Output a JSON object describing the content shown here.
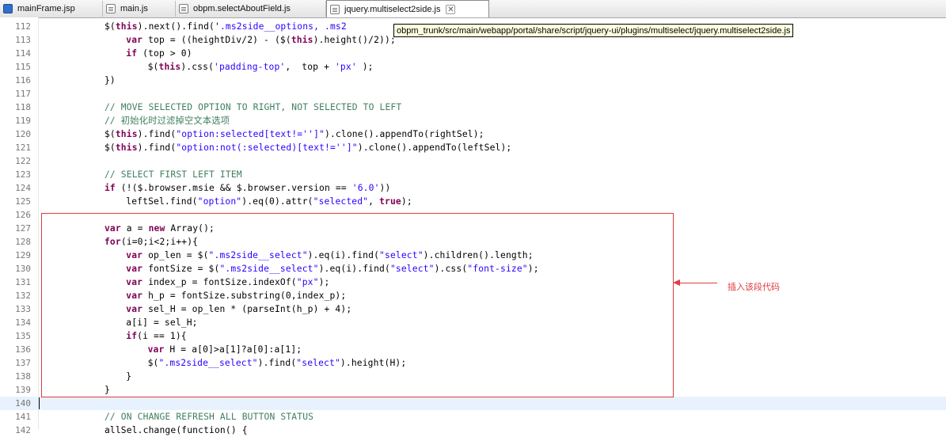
{
  "tabs": [
    {
      "label": "mainFrame.jsp",
      "icon": "jsp-file-icon"
    },
    {
      "label": "main.js",
      "icon": "js-file-icon"
    },
    {
      "label": "obpm.selectAboutField.js",
      "icon": "js-file-icon"
    },
    {
      "label": "jquery.multiselect2side.js",
      "icon": "js-file-icon",
      "active": true
    }
  ],
  "tooltip": "obpm_trunk/src/main/webapp/portal/share/script/jquery-ui/plugins/multiselect/jquery.multiselect2side.js",
  "annotation": {
    "text": "插入该段代码",
    "color": "#e23c3c"
  },
  "colors": {
    "keyword": "#7f0055",
    "string": "#2a00ff",
    "comment": "#3f7f5f",
    "line_number": "#787878"
  },
  "lines": [
    {
      "n": "112",
      "indent": 12,
      "tokens": [
        [
          "",
          "$("
        ],
        [
          "kw",
          "this"
        ],
        [
          "",
          ").next().find('"
        ],
        [
          "str",
          ".ms2side__options, .ms2"
        ]
      ]
    },
    {
      "n": "113",
      "indent": 16,
      "tokens": [
        [
          "kw",
          "var"
        ],
        [
          "",
          " top = ((heightDiv/2) - ($("
        ],
        [
          "kw",
          "this"
        ],
        [
          "",
          ").height()/2));"
        ]
      ]
    },
    {
      "n": "114",
      "indent": 16,
      "tokens": [
        [
          "kw",
          "if"
        ],
        [
          "",
          " (top > 0)"
        ]
      ]
    },
    {
      "n": "115",
      "indent": 20,
      "tokens": [
        [
          "",
          "$("
        ],
        [
          "kw",
          "this"
        ],
        [
          "",
          ").css("
        ],
        [
          "str",
          "'padding-top'"
        ],
        [
          "",
          ",  top + "
        ],
        [
          "str",
          "'px'"
        ],
        [
          "",
          " );"
        ]
      ]
    },
    {
      "n": "116",
      "indent": 12,
      "tokens": [
        [
          "",
          "})"
        ]
      ]
    },
    {
      "n": "117",
      "indent": 0,
      "tokens": []
    },
    {
      "n": "118",
      "indent": 12,
      "tokens": [
        [
          "cm",
          "// MOVE SELECTED OPTION TO RIGHT, NOT SELECTED TO LEFT"
        ]
      ]
    },
    {
      "n": "119",
      "indent": 12,
      "tokens": [
        [
          "cm",
          "// 初始化时过滤掉空文本选项"
        ]
      ]
    },
    {
      "n": "120",
      "indent": 12,
      "tokens": [
        [
          "",
          "$("
        ],
        [
          "kw",
          "this"
        ],
        [
          "",
          ").find("
        ],
        [
          "str",
          "\"option:selected[text!='']\""
        ],
        [
          "",
          ").clone().appendTo(rightSel);"
        ]
      ]
    },
    {
      "n": "121",
      "indent": 12,
      "tokens": [
        [
          "",
          "$("
        ],
        [
          "kw",
          "this"
        ],
        [
          "",
          ").find("
        ],
        [
          "str",
          "\"option:not(:selected)[text!='']\""
        ],
        [
          "",
          ").clone().appendTo(leftSel);"
        ]
      ]
    },
    {
      "n": "122",
      "indent": 0,
      "tokens": []
    },
    {
      "n": "123",
      "indent": 12,
      "tokens": [
        [
          "cm",
          "// SELECT FIRST LEFT ITEM"
        ]
      ]
    },
    {
      "n": "124",
      "indent": 12,
      "tokens": [
        [
          "kw",
          "if"
        ],
        [
          "",
          " (!($.browser.msie && $.browser.version == "
        ],
        [
          "str",
          "'6.0'"
        ],
        [
          "",
          "))"
        ]
      ]
    },
    {
      "n": "125",
      "indent": 16,
      "tokens": [
        [
          "",
          "leftSel.find("
        ],
        [
          "str",
          "\"option\""
        ],
        [
          "",
          ").eq(0).attr("
        ],
        [
          "str",
          "\"selected\""
        ],
        [
          "",
          ", "
        ],
        [
          "kw",
          "true"
        ],
        [
          "",
          ");"
        ]
      ]
    },
    {
      "n": "126",
      "indent": 0,
      "tokens": []
    },
    {
      "n": "127",
      "indent": 12,
      "tokens": [
        [
          "kw",
          "var"
        ],
        [
          "",
          " a = "
        ],
        [
          "kw",
          "new"
        ],
        [
          "",
          " Array();"
        ]
      ]
    },
    {
      "n": "128",
      "indent": 12,
      "tokens": [
        [
          "kw",
          "for"
        ],
        [
          "",
          "(i=0;i<2;i++){"
        ]
      ]
    },
    {
      "n": "129",
      "indent": 16,
      "tokens": [
        [
          "kw",
          "var"
        ],
        [
          "",
          " op_len = $("
        ],
        [
          "str",
          "\".ms2side__select\""
        ],
        [
          "",
          ").eq(i).find("
        ],
        [
          "str",
          "\"select\""
        ],
        [
          "",
          ").children().length;"
        ]
      ]
    },
    {
      "n": "130",
      "indent": 16,
      "tokens": [
        [
          "kw",
          "var"
        ],
        [
          "",
          " fontSize = $("
        ],
        [
          "str",
          "\".ms2side__select\""
        ],
        [
          "",
          ").eq(i).find("
        ],
        [
          "str",
          "\"select\""
        ],
        [
          "",
          ").css("
        ],
        [
          "str",
          "\"font-size\""
        ],
        [
          "",
          ");"
        ]
      ]
    },
    {
      "n": "131",
      "indent": 16,
      "tokens": [
        [
          "kw",
          "var"
        ],
        [
          "",
          " index_p = fontSize.indexOf("
        ],
        [
          "str",
          "\"px\""
        ],
        [
          "",
          ");"
        ]
      ]
    },
    {
      "n": "132",
      "indent": 16,
      "tokens": [
        [
          "kw",
          "var"
        ],
        [
          "",
          " h_p = fontSize.substring(0,index_p);"
        ]
      ]
    },
    {
      "n": "133",
      "indent": 16,
      "tokens": [
        [
          "kw",
          "var"
        ],
        [
          "",
          " sel_H = op_len * (parseInt(h_p) + 4);"
        ]
      ]
    },
    {
      "n": "134",
      "indent": 16,
      "tokens": [
        [
          "",
          "a[i] = sel_H;"
        ]
      ]
    },
    {
      "n": "135",
      "indent": 16,
      "tokens": [
        [
          "kw",
          "if"
        ],
        [
          "",
          "(i == 1){"
        ]
      ]
    },
    {
      "n": "136",
      "indent": 20,
      "tokens": [
        [
          "kw",
          "var"
        ],
        [
          "",
          " H = a[0]>a[1]?a[0]:a[1];"
        ]
      ]
    },
    {
      "n": "137",
      "indent": 20,
      "tokens": [
        [
          "",
          "$("
        ],
        [
          "str",
          "\".ms2side__select\""
        ],
        [
          "",
          ").find("
        ],
        [
          "str",
          "\"select\""
        ],
        [
          "",
          ").height(H);"
        ]
      ]
    },
    {
      "n": "138",
      "indent": 16,
      "tokens": [
        [
          "",
          "}"
        ]
      ]
    },
    {
      "n": "139",
      "indent": 12,
      "tokens": [
        [
          "",
          "}"
        ]
      ]
    },
    {
      "n": "140",
      "indent": 0,
      "tokens": [],
      "cursor": true
    },
    {
      "n": "141",
      "indent": 12,
      "tokens": [
        [
          "cm",
          "// ON CHANGE REFRESH ALL BUTTON STATUS"
        ]
      ]
    },
    {
      "n": "142",
      "indent": 12,
      "tokens": [
        [
          "",
          "allSel.change(function() {"
        ]
      ]
    }
  ]
}
